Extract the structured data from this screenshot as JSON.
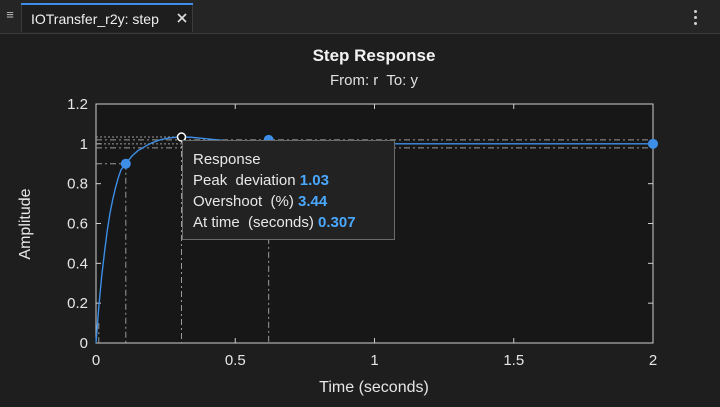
{
  "toolbar": {
    "tab_label": "IOTransfer_r2y: step",
    "menu_icon": "hamburger-icon",
    "close_icon": "close-icon",
    "more_icon": "vertical-dots-icon"
  },
  "chart_data": {
    "type": "line",
    "title": "Step Response",
    "subtitle": "From: r  To: y",
    "xlabel": "Time (seconds)",
    "ylabel": "Amplitude",
    "xlim": [
      0,
      2
    ],
    "ylim": [
      0,
      1.2
    ],
    "xticks": [
      0,
      0.5,
      1,
      1.5,
      2
    ],
    "xtick_labels": [
      "0",
      "0.5",
      "1",
      "1.5",
      "2"
    ],
    "yticks": [
      0,
      0.2,
      0.4,
      0.6,
      0.8,
      1,
      1.2
    ],
    "ytick_labels": [
      "0",
      "0.2",
      "0.4",
      "0.6",
      "0.8",
      "1",
      "1.2"
    ],
    "grid": false,
    "series": [
      {
        "x": [
          0,
          0.01,
          0.02,
          0.03,
          0.04,
          0.05,
          0.06,
          0.07,
          0.08,
          0.09,
          0.107,
          0.13,
          0.15,
          0.18,
          0.2,
          0.23,
          0.26,
          0.28,
          0.307,
          0.34,
          0.38,
          0.42,
          0.47,
          0.52,
          0.57,
          0.62,
          0.7,
          0.8,
          0.9,
          1.0,
          1.2,
          1.4,
          1.6,
          1.8,
          2.0
        ],
        "y": [
          0,
          0.18,
          0.33,
          0.45,
          0.56,
          0.65,
          0.72,
          0.78,
          0.83,
          0.87,
          0.9,
          0.94,
          0.965,
          0.99,
          1.005,
          1.02,
          1.029,
          1.032,
          1.034,
          1.033,
          1.028,
          1.022,
          1.016,
          1.012,
          1.009,
          1.006,
          1.003,
          1.001,
          1.0,
          1.0,
          1.0,
          1.0,
          1.0,
          1.0,
          1.0
        ],
        "color": "#3d8ee6"
      }
    ],
    "characteristic_points": [
      {
        "name": "rise-time",
        "x": 0.107,
        "y": 0.9
      },
      {
        "name": "peak",
        "x": 0.307,
        "y": 1.034
      },
      {
        "name": "settling-time",
        "x": 0.62,
        "y": 1.02
      },
      {
        "name": "steady-state",
        "x": 2.0,
        "y": 1.0
      }
    ],
    "tooltip": {
      "header": "Response",
      "rows": [
        {
          "label": "Peak  deviation",
          "value": "1.03"
        },
        {
          "label": "Overshoot  (%)",
          "value": "3.44"
        },
        {
          "label": "At time  (seconds)",
          "value": "0.307"
        }
      ]
    }
  }
}
